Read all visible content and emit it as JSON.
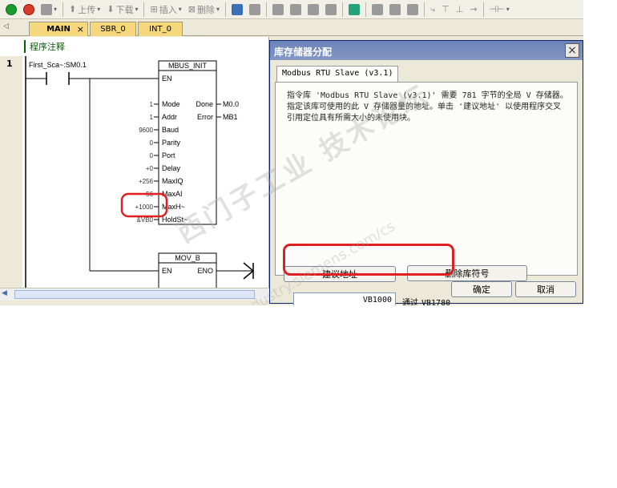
{
  "toolbar": {
    "upload_label": "上传",
    "download_label": "下载",
    "insert_label": "插入",
    "delete_label": "删除"
  },
  "tabs": {
    "main": "MAIN",
    "main_close": "×",
    "sbr": "SBR_0",
    "int": "INT_0"
  },
  "editor": {
    "program_comment": "程序注释",
    "network_number": "1",
    "contact_label": "First_Sca~:SM0.1",
    "mbus_init": {
      "title": "MBUS_INIT",
      "en": "EN",
      "inputs": [
        {
          "value": "1",
          "pin": "Mode"
        },
        {
          "value": "1",
          "pin": "Addr"
        },
        {
          "value": "9600",
          "pin": "Baud"
        },
        {
          "value": "0",
          "pin": "Parity"
        },
        {
          "value": "0",
          "pin": "Port"
        },
        {
          "value": "+0",
          "pin": "Delay"
        },
        {
          "value": "+256",
          "pin": "MaxIQ"
        },
        {
          "value": "56",
          "pin": "MaxAI"
        },
        {
          "value": "+1000",
          "pin": "MaxH~"
        },
        {
          "value": "&VB0",
          "pin": "HoldSt~"
        }
      ],
      "outputs": [
        {
          "pin": "Done",
          "value": "M0.0"
        },
        {
          "pin": "Error",
          "value": "MB1"
        }
      ]
    },
    "mov_b": {
      "title": "MOV_B",
      "en": "EN",
      "eno": "ENO"
    }
  },
  "dialog": {
    "title": "库存储器分配",
    "close": "×",
    "tab_label": "Modbus RTU Slave (v3.1)",
    "description": "指令库 'Modbus RTU Slave (v3.1)' 需要 781 字节的全局 V 存储器。指定该库可使用的此 V 存储器量的地址。单击 '建议地址' 以使用程序交叉引用定位具有所需大小的未使用块。",
    "suggest_button": "建议地址",
    "delete_symbols_button": "删除库符号",
    "address_value": "VB1000",
    "through_label": "通过",
    "end_address": "VB1780",
    "ok_button": "确定",
    "cancel_button": "取消"
  },
  "watermark": {
    "line1": "西门子工业 技术论坛",
    "line2": "support.industry.siemens.com/cs"
  },
  "colors": {
    "highlight": "#e02020",
    "tab_active": "#f6d87c",
    "dialog_title_bg": "#7b8fc0"
  }
}
